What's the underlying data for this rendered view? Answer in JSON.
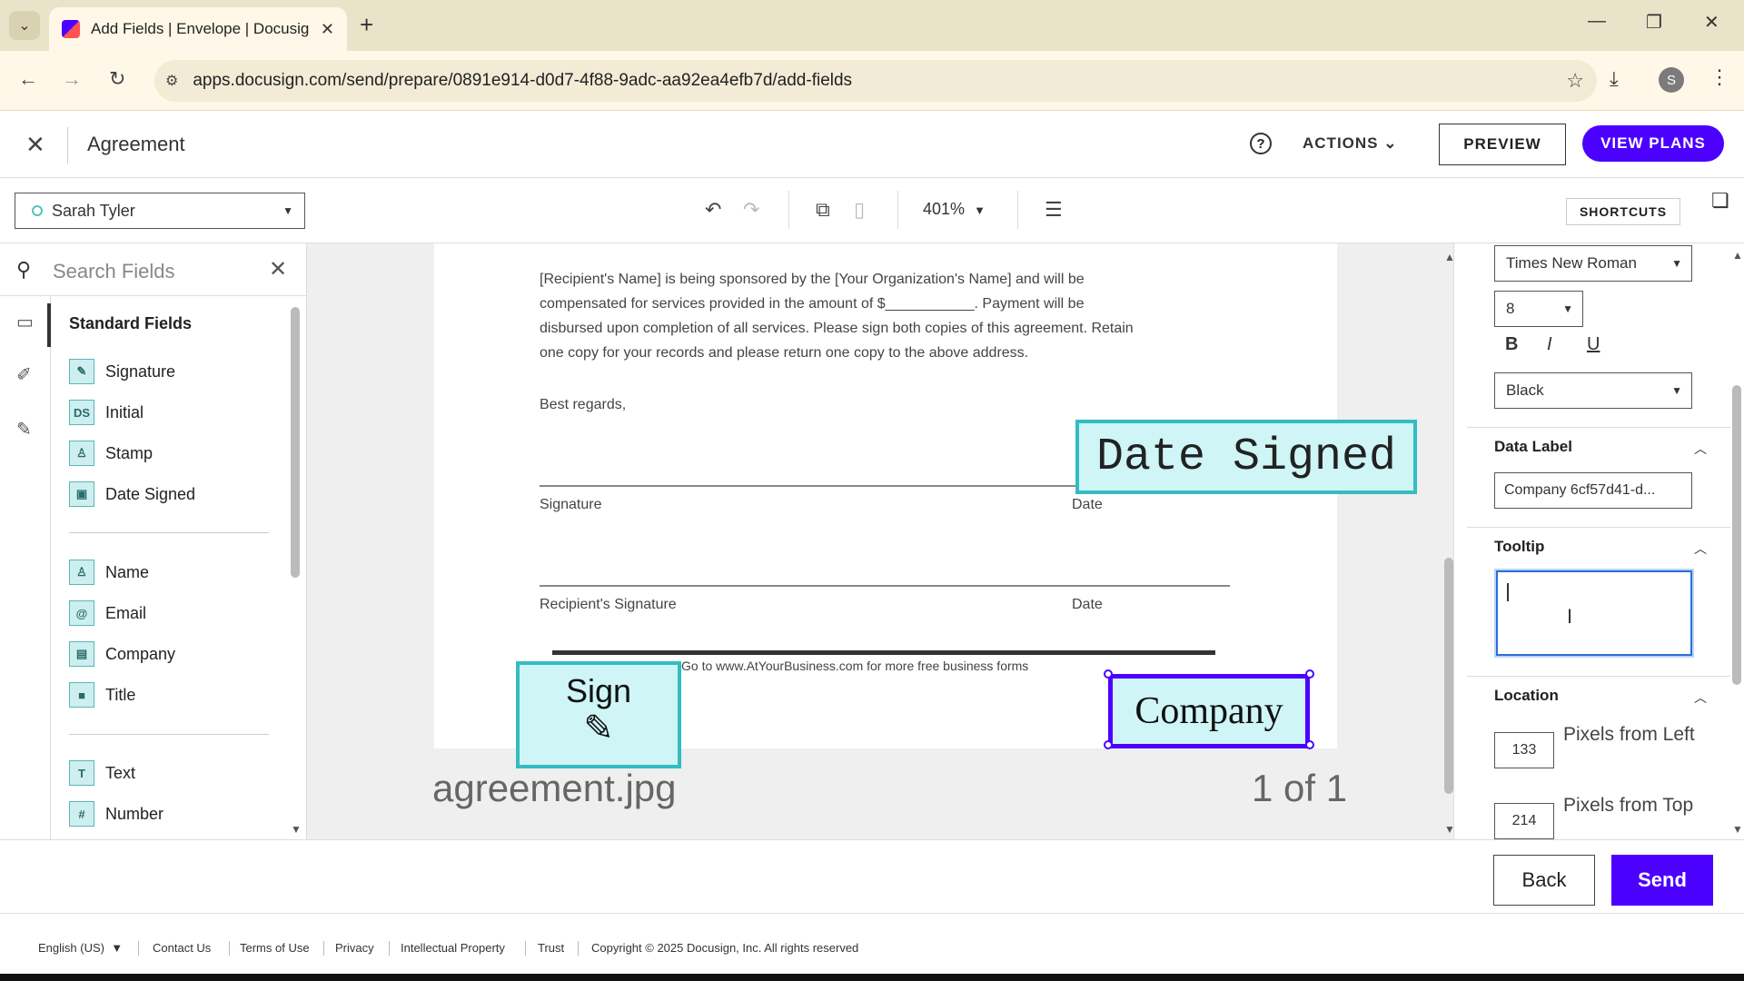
{
  "browser": {
    "tab_title": "Add Fields | Envelope | Docusig",
    "url": "apps.docusign.com/send/prepare/0891e914-d0d7-4f88-9adc-aa92ea4efb7d/add-fields",
    "profile_initial": "S"
  },
  "header": {
    "doc_title": "Agreement",
    "actions_label": "ACTIONS",
    "preview_label": "PREVIEW",
    "view_plans_label": "VIEW PLANS"
  },
  "subtoolbar": {
    "recipient": "Sarah Tyler",
    "zoom": "401%",
    "shortcuts_label": "SHORTCUTS"
  },
  "left_panel": {
    "search_placeholder": "Search Fields",
    "section_title": "Standard Fields",
    "fields": [
      {
        "label": "Signature",
        "icon": "✎"
      },
      {
        "label": "Initial",
        "icon": "DS"
      },
      {
        "label": "Stamp",
        "icon": "♙"
      },
      {
        "label": "Date Signed",
        "icon": "▣"
      },
      {
        "label": "Name",
        "icon": "♙"
      },
      {
        "label": "Email",
        "icon": "@"
      },
      {
        "label": "Company",
        "icon": "▤"
      },
      {
        "label": "Title",
        "icon": "■"
      },
      {
        "label": "Text",
        "icon": "T"
      },
      {
        "label": "Number",
        "icon": "#"
      }
    ]
  },
  "document": {
    "paragraph": [
      "[Recipient's Name] is being sponsored by the [Your Organization's Name] and will be",
      "compensated for services provided in the amount of $___________. Payment will be",
      "disbursed upon completion of all services. Please sign both copies of this agreement. Retain",
      "one copy for your records and please return one copy to the above address."
    ],
    "closing": "Best regards,",
    "sig_label_1": "Signature",
    "date_label_1": "Date",
    "sig_label_2": "Recipient's Signature",
    "date_label_2": "Date",
    "footer_text": "Go to www.AtYourBusiness.com for more free business forms",
    "field_date_signed": "Date Signed",
    "field_sign": "Sign",
    "field_company": "Company",
    "filename": "agreement.jpg",
    "page_indicator": "1 of 1"
  },
  "right_panel": {
    "font": "Times New Roman",
    "font_size": "8",
    "color": "Black",
    "data_label_title": "Data Label",
    "data_label_value": "Company 6cf57d41-d...",
    "tooltip_title": "Tooltip",
    "tooltip_value": "",
    "location_title": "Location",
    "pixels_from_left_value": "133",
    "pixels_from_left_label": "Pixels from Left",
    "pixels_from_top_value": "214",
    "pixels_from_top_label": "Pixels from Top"
  },
  "actions": {
    "back_label": "Back",
    "send_label": "Send"
  },
  "footer": {
    "language": "English (US)",
    "links": [
      "Contact Us",
      "Terms of Use",
      "Privacy",
      "Intellectual Property",
      "Trust"
    ],
    "copyright": "Copyright © 2025 Docusign, Inc. All rights reserved"
  }
}
